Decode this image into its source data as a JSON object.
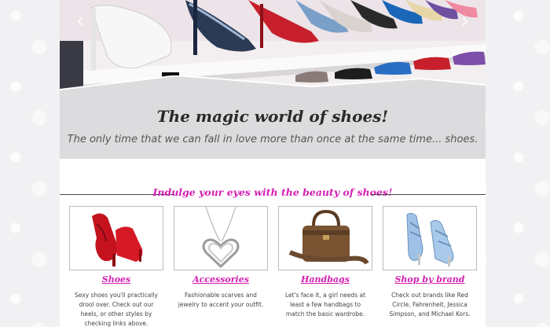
{
  "hero": {
    "prev_icon": "chevron-left-icon",
    "next_icon": "chevron-right-icon"
  },
  "banner": {
    "title": "The magic world of shoes!",
    "subtitle": "The only time that we can fall in love more than once at the same time... shoes."
  },
  "section": {
    "heading": "Indulge your eyes with the beauty of shoes!"
  },
  "cards": [
    {
      "title": "Shoes",
      "description": "Sexy shoes you'll practically drool over. Check out our heels, or other styles by checking links above.",
      "icon": "red-heels-image"
    },
    {
      "title": "Accessories",
      "description": "Fashionable scarves and jewelry to accent your outfit.",
      "icon": "heart-necklace-image"
    },
    {
      "title": "Handbags",
      "description": "Let's face it, a girl needs at least a few handbags to match the basic wardrobe.",
      "icon": "brown-handbag-image"
    },
    {
      "title": "Shop by brand",
      "description": "Check out brands like Red Circle, Fahrenheit, Jessica Simpson, and Michael Kors.",
      "icon": "blue-sandals-image"
    }
  ],
  "colors": {
    "accent": "#d41fb2",
    "band": "#dcdcde",
    "heading": "#2a2a2a"
  }
}
